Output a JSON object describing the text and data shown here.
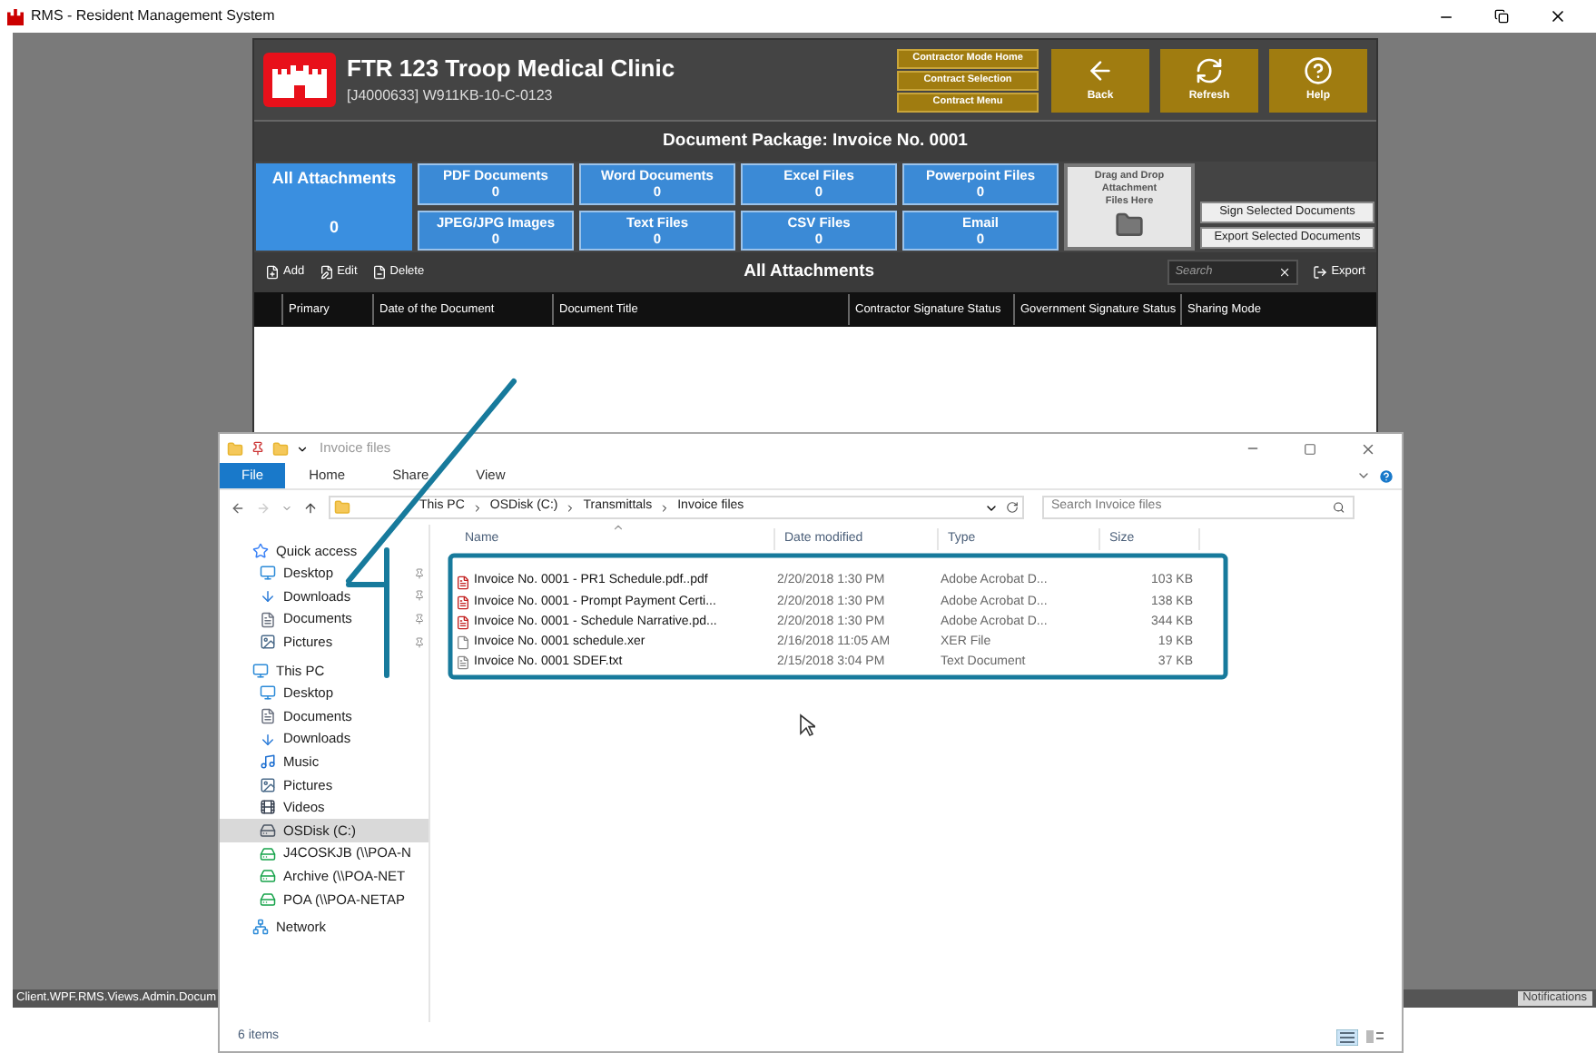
{
  "window": {
    "title": "RMS - Resident Management System"
  },
  "app": {
    "title": "FTR 123 Troop Medical Clinic",
    "subtitle": "[J4000633] W911KB-10-C-0123",
    "menu_links": [
      "Contractor Mode Home",
      "Contract Selection",
      "Contract Menu"
    ],
    "nav_buttons": [
      {
        "kind": "back",
        "label": "Back"
      },
      {
        "kind": "refresh",
        "label": "Refresh"
      },
      {
        "kind": "help",
        "label": "Help"
      }
    ],
    "package_title": "Document Package: Invoice No. 0001",
    "tiles": [
      {
        "label": "All Attachments",
        "count": "0",
        "selected": true
      },
      {
        "label": "PDF Documents",
        "count": "0",
        "selected": false
      },
      {
        "label": "Word Documents",
        "count": "0",
        "selected": false
      },
      {
        "label": "Excel Files",
        "count": "0",
        "selected": false
      },
      {
        "label": "Powerpoint Files",
        "count": "0",
        "selected": false
      },
      {
        "label": "JPEG/JPG Images",
        "count": "0",
        "selected": false
      },
      {
        "label": "Text Files",
        "count": "0",
        "selected": false
      },
      {
        "label": "CSV Files",
        "count": "0",
        "selected": false
      },
      {
        "label": "Email",
        "count": "0",
        "selected": false
      }
    ],
    "drop_zone": "Drag and Drop Attachment Files Here",
    "side_buttons": [
      "Sign Selected Documents",
      "Export Selected Documents"
    ],
    "toolbar": {
      "actions": [
        {
          "kind": "add",
          "label": "Add"
        },
        {
          "kind": "edit",
          "label": "Edit"
        },
        {
          "kind": "delete",
          "label": "Delete"
        }
      ],
      "title": "All Attachments",
      "search_placeholder": "Search",
      "export": "Export"
    },
    "table": {
      "columns": [
        "Primary",
        "Date of the Document",
        "Document Title",
        "Contractor Signature Status",
        "Government Signature Status",
        "Sharing Mode"
      ]
    },
    "status_bar": {
      "left": "Client.WPF.RMS.Views.Admin.Docum",
      "right": "Notifications"
    }
  },
  "explorer": {
    "title": "Invoice files",
    "ribbon_tabs": [
      {
        "label": "File",
        "selected": true
      },
      {
        "label": "Home",
        "selected": false
      },
      {
        "label": "Share",
        "selected": false
      },
      {
        "label": "View",
        "selected": false
      }
    ],
    "breadcrumb": [
      "This PC",
      "OSDisk (C:)",
      "Transmittals",
      "Invoice files"
    ],
    "search": {
      "placeholder": "Search Invoice files"
    },
    "sidebar": [
      {
        "label": "Quick access",
        "kind": "star",
        "selected": false,
        "children": [
          {
            "label": "Desktop",
            "kind": "monitor",
            "pinned": true,
            "selected": false
          },
          {
            "label": "Downloads",
            "kind": "download",
            "pinned": true,
            "selected": false
          },
          {
            "label": "Documents",
            "kind": "document",
            "pinned": true,
            "selected": false
          },
          {
            "label": "Pictures",
            "kind": "picture",
            "pinned": true,
            "selected": false
          }
        ]
      },
      {
        "label": "This PC",
        "kind": "monitor",
        "selected": false,
        "children": [
          {
            "label": "Desktop",
            "kind": "monitor",
            "selected": false
          },
          {
            "label": "Documents",
            "kind": "document",
            "selected": false
          },
          {
            "label": "Downloads",
            "kind": "download",
            "selected": false
          },
          {
            "label": "Music",
            "kind": "music",
            "selected": false
          },
          {
            "label": "Pictures",
            "kind": "picture",
            "selected": false
          },
          {
            "label": "Videos",
            "kind": "video",
            "selected": false
          },
          {
            "label": "OSDisk (C:)",
            "kind": "drive",
            "selected": true
          },
          {
            "label": "J4COSKJB (\\\\POA-N",
            "kind": "netdrive",
            "selected": false
          },
          {
            "label": "Archive (\\\\POA-NET",
            "kind": "netdrive",
            "selected": false
          },
          {
            "label": "POA (\\\\POA-NETAP",
            "kind": "netdrive",
            "selected": false
          }
        ]
      },
      {
        "label": "Network",
        "kind": "network",
        "selected": false
      }
    ],
    "columns": [
      "Name",
      "Date modified",
      "Type",
      "Size"
    ],
    "files": [
      {
        "kind": "pdf",
        "name": "Invoice No. 0001 - PR1 Schedule.pdf..pdf",
        "date": "2/20/2018 1:30 PM",
        "type": "Adobe Acrobat D...",
        "size": "103 KB"
      },
      {
        "kind": "pdf",
        "name": "Invoice No. 0001 - Prompt Payment Certi...",
        "date": "2/20/2018 1:30 PM",
        "type": "Adobe Acrobat D...",
        "size": "138 KB"
      },
      {
        "kind": "pdf",
        "name": "Invoice No. 0001 - Schedule Narrative.pd...",
        "date": "2/20/2018 1:30 PM",
        "type": "Adobe Acrobat D...",
        "size": "344 KB"
      },
      {
        "kind": "file",
        "name": "Invoice No. 0001 schedule.xer",
        "date": "2/16/2018 11:05 AM",
        "type": "XER File",
        "size": "19 KB"
      },
      {
        "kind": "text",
        "name": "Invoice No. 0001 SDEF.txt",
        "date": "2/15/2018 3:04 PM",
        "type": "Text Document",
        "size": "37 KB"
      }
    ],
    "status": "6 items"
  }
}
